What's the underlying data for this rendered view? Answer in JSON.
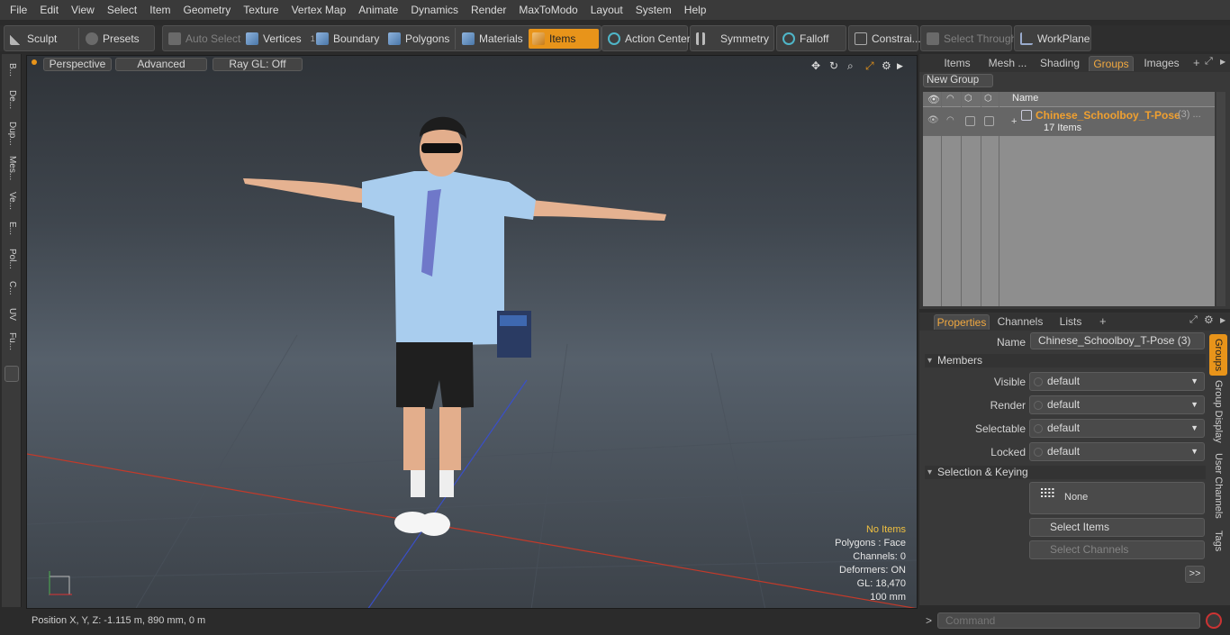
{
  "menu": [
    "File",
    "Edit",
    "View",
    "Select",
    "Item",
    "Geometry",
    "Texture",
    "Vertex Map",
    "Animate",
    "Dynamics",
    "Render",
    "MaxToModo",
    "Layout",
    "System",
    "Help"
  ],
  "toolbar": {
    "sculpt": "Sculpt",
    "presets": "Presets",
    "auto_select": "Auto Select",
    "vertices": "Vertices",
    "vertices_count": "1",
    "boundary": "Boundary",
    "polygons": "Polygons",
    "materials": "Materials",
    "items": "Items",
    "action_center": "Action Center",
    "symmetry": "Symmetry",
    "falloff": "Falloff",
    "constraints": "Constrai...",
    "select_through": "Select Through",
    "workplane": "WorkPlane"
  },
  "left_tabs": [
    "B...",
    "De...",
    "Dup...",
    "Mes...",
    "Ve...",
    "E...",
    "Pol...",
    "C...",
    "UV",
    "Fu..."
  ],
  "viewport": {
    "view_mode": "Perspective",
    "shading": "Advanced",
    "raygl": "Ray GL: Off",
    "info": {
      "selection": "No Items",
      "polygons": "Polygons : Face",
      "channels": "Channels: 0",
      "deformers": "Deformers: ON",
      "gl": "GL: 18,470",
      "scale": "100 mm"
    }
  },
  "statusbar": {
    "position": "Position X, Y, Z:   -1.115 m, 890 mm, 0 m"
  },
  "right_top": {
    "tabs": [
      "Items",
      "Mesh ...",
      "Shading",
      "Groups",
      "Images"
    ],
    "active_tab": "Groups",
    "new_group": "New Group",
    "name_header": "Name",
    "group": {
      "name": "Chinese_Schoolboy_T-Pose",
      "suffix": "(3) ...",
      "count": "17 Items"
    }
  },
  "right_bottom": {
    "tabs": [
      "Properties",
      "Channels",
      "Lists"
    ],
    "active_tab": "Properties",
    "name_label": "Name",
    "name_value": "Chinese_Schoolboy_T-Pose (3)",
    "members_section": "Members",
    "visible_label": "Visible",
    "visible_value": "default",
    "render_label": "Render",
    "render_value": "default",
    "selectable_label": "Selectable",
    "selectable_value": "default",
    "locked_label": "Locked",
    "locked_value": "default",
    "keying_section": "Selection & Keying",
    "none_label": "None",
    "select_items": "Select Items",
    "select_channels": "Select Channels",
    "more": ">>",
    "vertical_tabs": [
      "Groups",
      "Group Display",
      "User Channels",
      "Tags"
    ]
  },
  "command": {
    "prompt": ">",
    "placeholder": "Command"
  },
  "colors": {
    "accent": "#e8941a",
    "group_name": "#f0a030"
  }
}
